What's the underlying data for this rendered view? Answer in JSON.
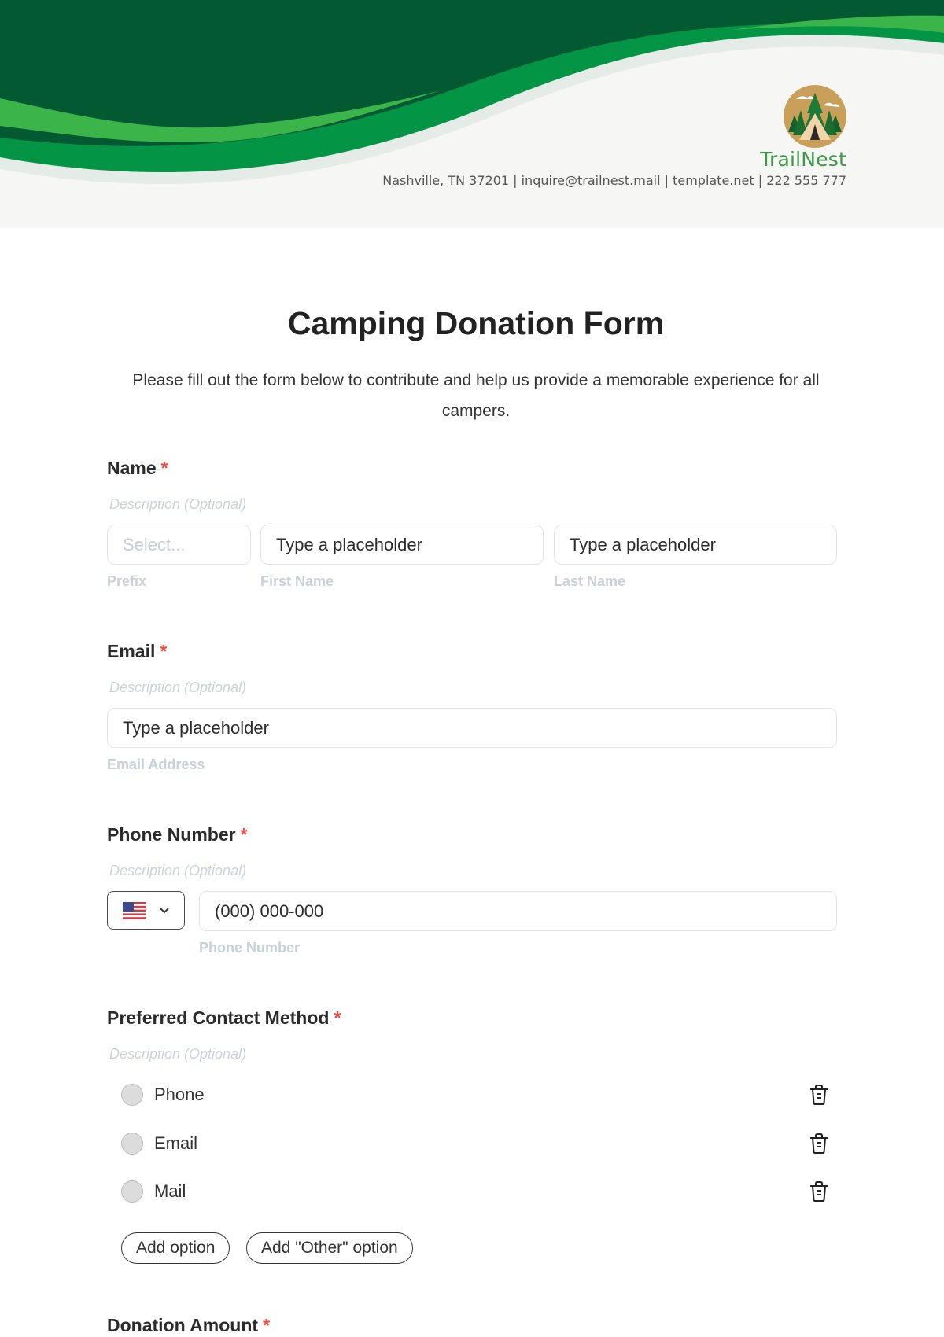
{
  "header": {
    "brand_name": "TrailNest",
    "contact_line": "Nashville, TN 37201 | inquire@trailnest.mail | template.net | 222 555 777",
    "colors": {
      "dark_green": "#035a32",
      "mid_green": "#049446",
      "light_green": "#3bb54a",
      "background": "#f6f6f5"
    }
  },
  "form": {
    "title": "Camping Donation Form",
    "subtitle": "Please fill out the form below to contribute and help us provide a memorable experience for all campers.",
    "required_marker": "*",
    "description_placeholder": "Description (Optional)",
    "fields": {
      "name": {
        "label": "Name",
        "prefix": {
          "placeholder": "Select...",
          "sublabel": "Prefix"
        },
        "first_name": {
          "placeholder": "Type a placeholder",
          "sublabel": "First Name"
        },
        "last_name": {
          "placeholder": "Type a placeholder",
          "sublabel": "Last Name"
        }
      },
      "email": {
        "label": "Email",
        "placeholder": "Type a placeholder",
        "sublabel": "Email Address"
      },
      "phone": {
        "label": "Phone Number",
        "country_icon": "us-flag-icon",
        "placeholder": "(000) 000-000",
        "sublabel": "Phone Number"
      },
      "contact_method": {
        "label": "Preferred Contact Method",
        "options": [
          "Phone",
          "Email",
          "Mail"
        ],
        "add_option_label": "Add option",
        "add_other_label": "Add \"Other\" option"
      },
      "donation_amount": {
        "label": "Donation Amount"
      }
    }
  }
}
